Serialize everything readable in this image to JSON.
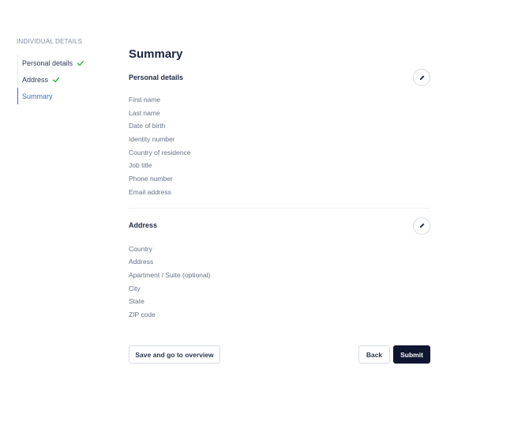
{
  "sidebar": {
    "heading": "INDIVIDUAL DETAILS",
    "steps": [
      {
        "label": "Personal details",
        "status": "complete"
      },
      {
        "label": "Address",
        "status": "complete"
      },
      {
        "label": "Summary",
        "status": "current"
      }
    ]
  },
  "main": {
    "title": "Summary",
    "personal": {
      "title": "Personal details",
      "edit_icon": "pencil-icon",
      "fields": [
        "First name",
        "Last name",
        "Date of birth",
        "Identity number",
        "Country of residence",
        "Job title",
        "Phone number",
        "Email address"
      ]
    },
    "address": {
      "title": "Address",
      "edit_icon": "pencil-icon",
      "fields": [
        "Country",
        "Address",
        "Apartment / Suite (optional)",
        "City",
        "State",
        "ZIP code"
      ]
    }
  },
  "footer": {
    "save_label": "Save and go to overview",
    "back_label": "Back",
    "submit_label": "Submit"
  },
  "colors": {
    "accent": "#3b6fd9",
    "success": "#2bb24c",
    "primary_button": "#0f1630"
  }
}
